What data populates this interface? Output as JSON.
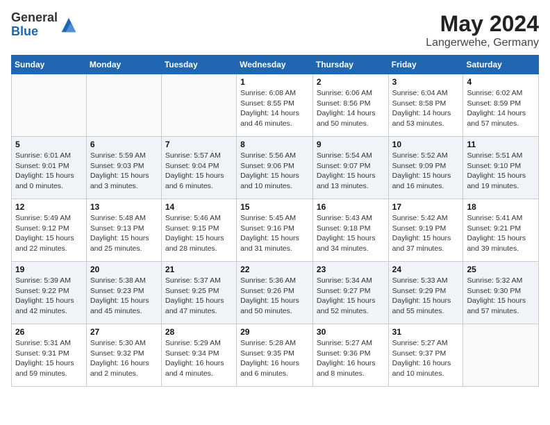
{
  "logo": {
    "general": "General",
    "blue": "Blue"
  },
  "header": {
    "month": "May 2024",
    "location": "Langerwehe, Germany"
  },
  "weekdays": [
    "Sunday",
    "Monday",
    "Tuesday",
    "Wednesday",
    "Thursday",
    "Friday",
    "Saturday"
  ],
  "weeks": [
    [
      {
        "day": "",
        "sunrise": "",
        "sunset": "",
        "daylight": ""
      },
      {
        "day": "",
        "sunrise": "",
        "sunset": "",
        "daylight": ""
      },
      {
        "day": "",
        "sunrise": "",
        "sunset": "",
        "daylight": ""
      },
      {
        "day": "1",
        "sunrise": "Sunrise: 6:08 AM",
        "sunset": "Sunset: 8:55 PM",
        "daylight": "Daylight: 14 hours and 46 minutes."
      },
      {
        "day": "2",
        "sunrise": "Sunrise: 6:06 AM",
        "sunset": "Sunset: 8:56 PM",
        "daylight": "Daylight: 14 hours and 50 minutes."
      },
      {
        "day": "3",
        "sunrise": "Sunrise: 6:04 AM",
        "sunset": "Sunset: 8:58 PM",
        "daylight": "Daylight: 14 hours and 53 minutes."
      },
      {
        "day": "4",
        "sunrise": "Sunrise: 6:02 AM",
        "sunset": "Sunset: 8:59 PM",
        "daylight": "Daylight: 14 hours and 57 minutes."
      }
    ],
    [
      {
        "day": "5",
        "sunrise": "Sunrise: 6:01 AM",
        "sunset": "Sunset: 9:01 PM",
        "daylight": "Daylight: 15 hours and 0 minutes."
      },
      {
        "day": "6",
        "sunrise": "Sunrise: 5:59 AM",
        "sunset": "Sunset: 9:03 PM",
        "daylight": "Daylight: 15 hours and 3 minutes."
      },
      {
        "day": "7",
        "sunrise": "Sunrise: 5:57 AM",
        "sunset": "Sunset: 9:04 PM",
        "daylight": "Daylight: 15 hours and 6 minutes."
      },
      {
        "day": "8",
        "sunrise": "Sunrise: 5:56 AM",
        "sunset": "Sunset: 9:06 PM",
        "daylight": "Daylight: 15 hours and 10 minutes."
      },
      {
        "day": "9",
        "sunrise": "Sunrise: 5:54 AM",
        "sunset": "Sunset: 9:07 PM",
        "daylight": "Daylight: 15 hours and 13 minutes."
      },
      {
        "day": "10",
        "sunrise": "Sunrise: 5:52 AM",
        "sunset": "Sunset: 9:09 PM",
        "daylight": "Daylight: 15 hours and 16 minutes."
      },
      {
        "day": "11",
        "sunrise": "Sunrise: 5:51 AM",
        "sunset": "Sunset: 9:10 PM",
        "daylight": "Daylight: 15 hours and 19 minutes."
      }
    ],
    [
      {
        "day": "12",
        "sunrise": "Sunrise: 5:49 AM",
        "sunset": "Sunset: 9:12 PM",
        "daylight": "Daylight: 15 hours and 22 minutes."
      },
      {
        "day": "13",
        "sunrise": "Sunrise: 5:48 AM",
        "sunset": "Sunset: 9:13 PM",
        "daylight": "Daylight: 15 hours and 25 minutes."
      },
      {
        "day": "14",
        "sunrise": "Sunrise: 5:46 AM",
        "sunset": "Sunset: 9:15 PM",
        "daylight": "Daylight: 15 hours and 28 minutes."
      },
      {
        "day": "15",
        "sunrise": "Sunrise: 5:45 AM",
        "sunset": "Sunset: 9:16 PM",
        "daylight": "Daylight: 15 hours and 31 minutes."
      },
      {
        "day": "16",
        "sunrise": "Sunrise: 5:43 AM",
        "sunset": "Sunset: 9:18 PM",
        "daylight": "Daylight: 15 hours and 34 minutes."
      },
      {
        "day": "17",
        "sunrise": "Sunrise: 5:42 AM",
        "sunset": "Sunset: 9:19 PM",
        "daylight": "Daylight: 15 hours and 37 minutes."
      },
      {
        "day": "18",
        "sunrise": "Sunrise: 5:41 AM",
        "sunset": "Sunset: 9:21 PM",
        "daylight": "Daylight: 15 hours and 39 minutes."
      }
    ],
    [
      {
        "day": "19",
        "sunrise": "Sunrise: 5:39 AM",
        "sunset": "Sunset: 9:22 PM",
        "daylight": "Daylight: 15 hours and 42 minutes."
      },
      {
        "day": "20",
        "sunrise": "Sunrise: 5:38 AM",
        "sunset": "Sunset: 9:23 PM",
        "daylight": "Daylight: 15 hours and 45 minutes."
      },
      {
        "day": "21",
        "sunrise": "Sunrise: 5:37 AM",
        "sunset": "Sunset: 9:25 PM",
        "daylight": "Daylight: 15 hours and 47 minutes."
      },
      {
        "day": "22",
        "sunrise": "Sunrise: 5:36 AM",
        "sunset": "Sunset: 9:26 PM",
        "daylight": "Daylight: 15 hours and 50 minutes."
      },
      {
        "day": "23",
        "sunrise": "Sunrise: 5:34 AM",
        "sunset": "Sunset: 9:27 PM",
        "daylight": "Daylight: 15 hours and 52 minutes."
      },
      {
        "day": "24",
        "sunrise": "Sunrise: 5:33 AM",
        "sunset": "Sunset: 9:29 PM",
        "daylight": "Daylight: 15 hours and 55 minutes."
      },
      {
        "day": "25",
        "sunrise": "Sunrise: 5:32 AM",
        "sunset": "Sunset: 9:30 PM",
        "daylight": "Daylight: 15 hours and 57 minutes."
      }
    ],
    [
      {
        "day": "26",
        "sunrise": "Sunrise: 5:31 AM",
        "sunset": "Sunset: 9:31 PM",
        "daylight": "Daylight: 15 hours and 59 minutes."
      },
      {
        "day": "27",
        "sunrise": "Sunrise: 5:30 AM",
        "sunset": "Sunset: 9:32 PM",
        "daylight": "Daylight: 16 hours and 2 minutes."
      },
      {
        "day": "28",
        "sunrise": "Sunrise: 5:29 AM",
        "sunset": "Sunset: 9:34 PM",
        "daylight": "Daylight: 16 hours and 4 minutes."
      },
      {
        "day": "29",
        "sunrise": "Sunrise: 5:28 AM",
        "sunset": "Sunset: 9:35 PM",
        "daylight": "Daylight: 16 hours and 6 minutes."
      },
      {
        "day": "30",
        "sunrise": "Sunrise: 5:27 AM",
        "sunset": "Sunset: 9:36 PM",
        "daylight": "Daylight: 16 hours and 8 minutes."
      },
      {
        "day": "31",
        "sunrise": "Sunrise: 5:27 AM",
        "sunset": "Sunset: 9:37 PM",
        "daylight": "Daylight: 16 hours and 10 minutes."
      },
      {
        "day": "",
        "sunrise": "",
        "sunset": "",
        "daylight": ""
      }
    ]
  ]
}
